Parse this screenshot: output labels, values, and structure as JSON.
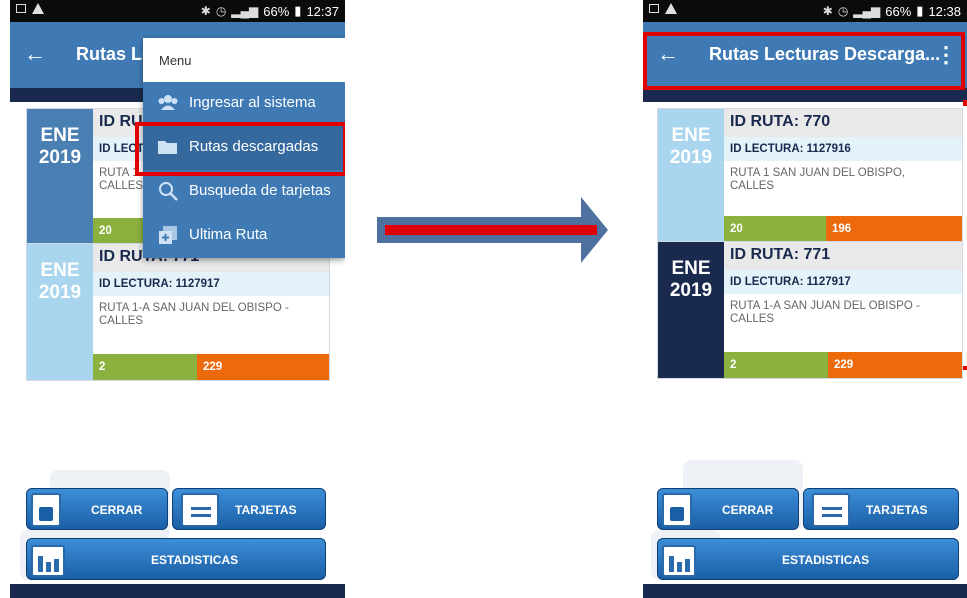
{
  "left_screen": {
    "status": {
      "battery": "66%",
      "time": "12:37"
    },
    "appbar": {
      "back": "←",
      "title": "Rutas Le"
    },
    "menu": {
      "header": "Menu",
      "items": [
        {
          "label": "Ingresar al sistema"
        },
        {
          "label": "Rutas descargadas"
        },
        {
          "label": "Busqueda de tarjetas"
        },
        {
          "label": "Ultima Ruta"
        }
      ]
    },
    "cards": [
      {
        "month": "ENE",
        "year": "2019",
        "id_ruta": "ID RU",
        "id_lectura": "ID LECTU",
        "desc": "RUTA 1\nCALLES",
        "green": "20",
        "orange": ""
      },
      {
        "month": "ENE",
        "year": "2019",
        "id_ruta": "ID RUTA: 771",
        "id_lectura": "ID LECTURA: 1127917",
        "desc": "RUTA 1-A SAN JUAN DEL OBISPO -\nCALLES",
        "green": "2",
        "orange": "229"
      }
    ],
    "buttons": {
      "cerrar": "CERRAR",
      "tarjetas": "TARJETAS",
      "estadisticas": "ESTADISTICAS"
    }
  },
  "right_screen": {
    "status": {
      "battery": "66%",
      "time": "12:38"
    },
    "appbar": {
      "back": "←",
      "title": "Rutas Lecturas Descarga...",
      "more": "⋮"
    },
    "cards": [
      {
        "month": "ENE",
        "year": "2019",
        "id_ruta": "ID RUTA: 770",
        "id_lectura": "ID LECTURA: 1127916",
        "desc": "RUTA 1 SAN JUAN DEL OBISPO,\nCALLES",
        "green": "20",
        "orange": "196"
      },
      {
        "month": "ENE",
        "year": "2019",
        "id_ruta": "ID RUTA: 771",
        "id_lectura": "ID LECTURA: 1127917",
        "desc": "RUTA 1-A SAN JUAN DEL OBISPO -\nCALLES",
        "green": "2",
        "orange": "229"
      }
    ],
    "buttons": {
      "cerrar": "CERRAR",
      "tarjetas": "TARJETAS",
      "estadisticas": "ESTADISTICAS"
    }
  },
  "colors": {
    "appbar": "#3f7ab4",
    "dark_navy": "#1a2a4e",
    "light_blue_month": "#a9d6ee",
    "mid_blue_month": "#4a7fb3",
    "green": "#8bb13e",
    "orange": "#ec6a0c",
    "highlight_red": "#e00000",
    "arrow_blue": "#4f71a0"
  }
}
